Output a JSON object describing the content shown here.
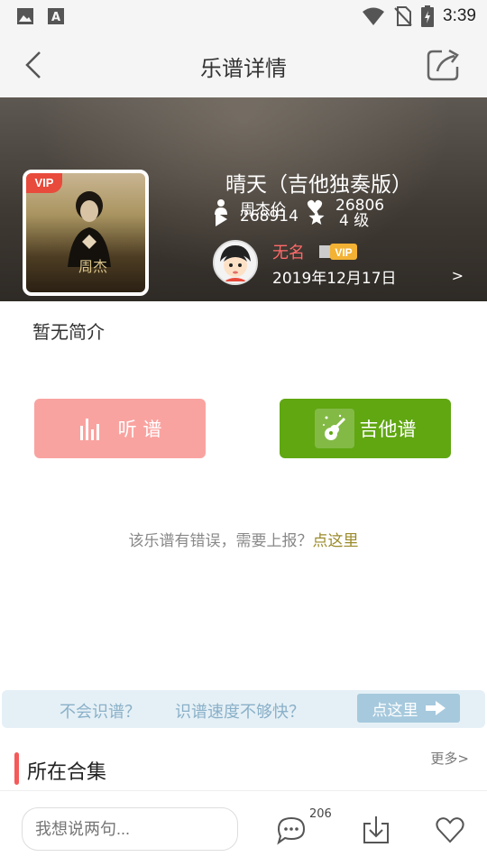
{
  "status_bar": {
    "time": "3:39"
  },
  "top_bar": {
    "title": "乐谱详情"
  },
  "song": {
    "title": "晴天（吉他独奏版）",
    "artist": "周杰伦",
    "likes": "26806",
    "views": "268914",
    "level": "4 级",
    "cover_badge": "VIP",
    "cover_text": "周杰"
  },
  "uploader": {
    "name": "无名",
    "badge": "VIP",
    "date": "2019年12月17日",
    "chevron": ">"
  },
  "intro": "暂无简介",
  "buttons": {
    "listen": "听 谱",
    "guitar": "吉他谱"
  },
  "report": {
    "text": "该乐谱有错误，需要上报？",
    "link": "点这里"
  },
  "promo": {
    "text1": "不会识谱？",
    "text2": "识谱速度不够快？",
    "button": "点这里"
  },
  "collection": {
    "title": "所在合集",
    "more": "更多>"
  },
  "bottom_bar": {
    "comment_placeholder": "我想说两句...",
    "comment_count": "206"
  },
  "colors": {
    "listen_btn": "#f9a3a0",
    "guitar_btn": "#60a712",
    "accent_red": "#f45a5a",
    "username": "#ff6a6a"
  },
  "icons": [
    "image-icon",
    "font-icon",
    "wifi-icon",
    "no-sim-icon",
    "battery-icon",
    "back-icon",
    "share-icon",
    "person-icon",
    "heart-icon",
    "play-icon",
    "star-icon",
    "equalizer-icon",
    "guitar-icon",
    "arrow-right-icon",
    "comment-icon",
    "download-icon",
    "like-icon"
  ]
}
